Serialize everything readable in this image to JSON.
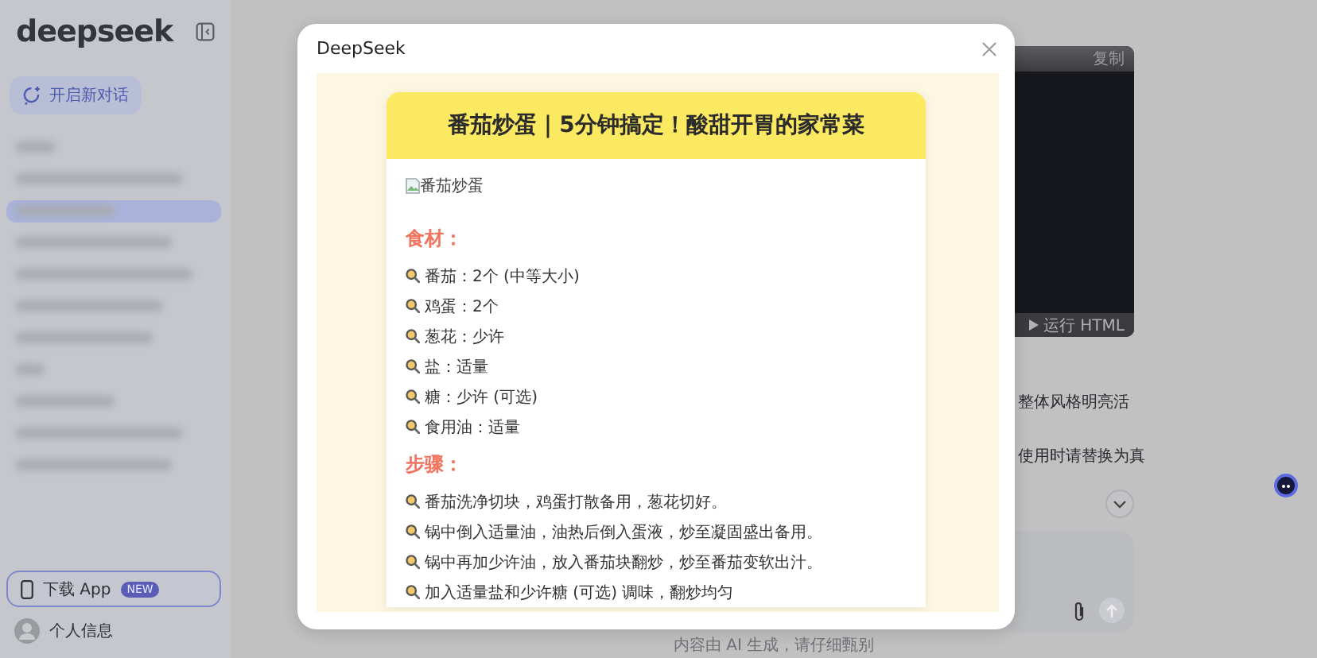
{
  "sidebar": {
    "logo": "deepseek",
    "new_chat": "开启新对话",
    "history": [
      {
        "selected": false
      },
      {
        "selected": false
      },
      {
        "selected": true
      },
      {
        "selected": false
      },
      {
        "selected": false
      },
      {
        "selected": false
      },
      {
        "selected": false
      },
      {
        "selected": false
      },
      {
        "selected": false
      },
      {
        "selected": false
      },
      {
        "selected": false
      }
    ],
    "download_app": {
      "label": "下载 App",
      "badge": "NEW"
    },
    "profile": "个人信息"
  },
  "main": {
    "code_block": {
      "copy": "复制",
      "run": "运行 HTML"
    },
    "lines": [
      "整体风格明亮活",
      "使用时请替换为真"
    ],
    "footer": "内容由 AI 生成，请仔细甄别"
  },
  "dialog": {
    "title": "DeepSeek",
    "recipe": {
      "title": "番茄炒蛋｜5分钟搞定！酸甜开胃的家常菜",
      "image_alt": "番茄炒蛋",
      "sections": [
        {
          "heading": "食材：",
          "items": [
            "番茄：2个 (中等大小)",
            "鸡蛋：2个",
            "葱花：少许",
            "盐：适量",
            "糖：少许 (可选)",
            "食用油：适量"
          ]
        },
        {
          "heading": "步骤：",
          "items": [
            "番茄洗净切块，鸡蛋打散备用，葱花切好。",
            "锅中倒入适量油，油热后倒入蛋液，炒至凝固盛出备用。",
            "锅中再加少许油，放入番茄块翻炒，炒至番茄变软出汁。",
            "加入适量盐和少许糖 (可选) 调味，翻炒均匀"
          ]
        }
      ]
    }
  }
}
